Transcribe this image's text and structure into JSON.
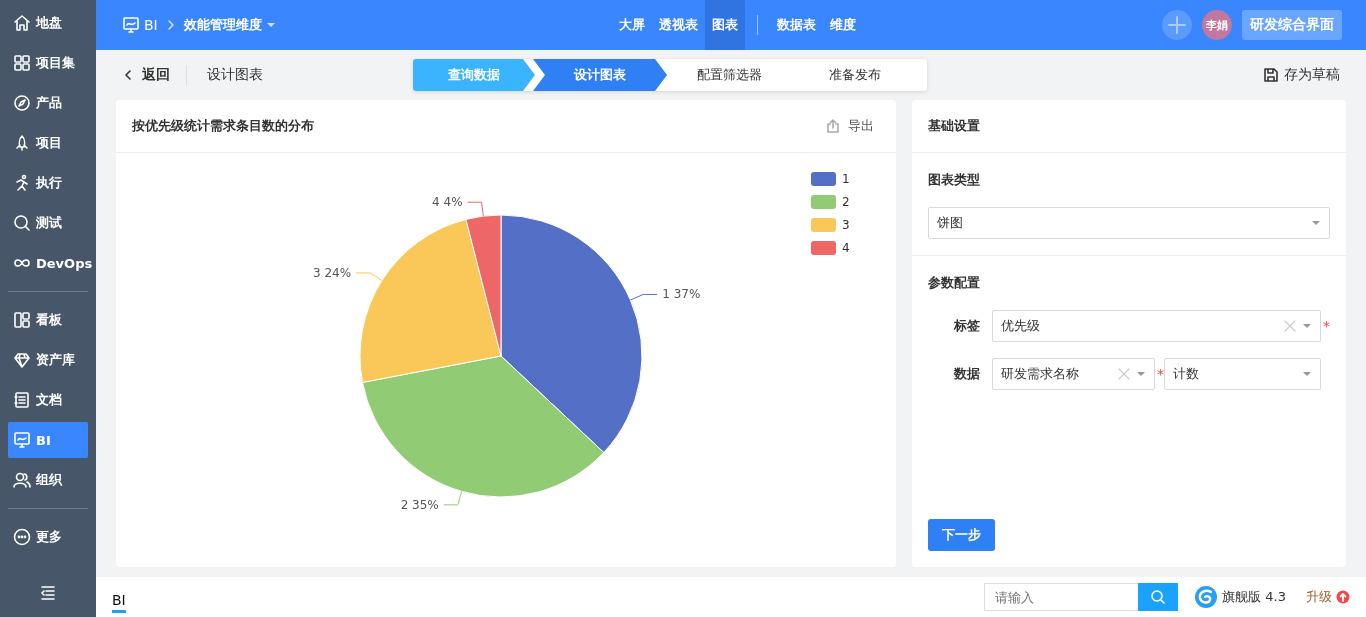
{
  "sidebar": {
    "groups": [
      [
        {
          "label": "地盘",
          "selected": false
        },
        {
          "label": "项目集",
          "selected": false
        },
        {
          "label": "产品",
          "selected": false
        },
        {
          "label": "项目",
          "selected": false
        },
        {
          "label": "执行",
          "selected": false
        },
        {
          "label": "测试",
          "selected": false
        },
        {
          "label": "DevOps",
          "selected": false
        }
      ],
      [
        {
          "label": "看板",
          "selected": false
        },
        {
          "label": "资产库",
          "selected": false
        },
        {
          "label": "文档",
          "selected": false
        },
        {
          "label": "BI",
          "selected": true
        },
        {
          "label": "组织",
          "selected": false
        }
      ],
      [
        {
          "label": "更多",
          "selected": false
        }
      ]
    ]
  },
  "header": {
    "app": "BI",
    "breadcrumb": "效能管理维度",
    "nav": [
      {
        "label": "大屏",
        "selected": false
      },
      {
        "label": "透视表",
        "selected": false
      },
      {
        "label": "图表",
        "selected": true
      }
    ],
    "nav2": [
      {
        "label": "数据表",
        "selected": false
      },
      {
        "label": "维度",
        "selected": false
      }
    ],
    "avatar": "李娟",
    "workspace_button": "研发综合界面"
  },
  "subheader": {
    "back": "返回",
    "title": "设计图表",
    "steps": [
      {
        "label": "查询数据",
        "completed": true,
        "selected": false
      },
      {
        "label": "设计图表",
        "completed": false,
        "selected": true
      },
      {
        "label": "配置筛选器",
        "completed": false,
        "selected": false
      },
      {
        "label": "准备发布",
        "completed": false,
        "selected": false
      }
    ],
    "save": "存为草稿"
  },
  "chart_panel": {
    "title": "按优先级统计需求条目数的分布",
    "export": "导出",
    "legend": [
      {
        "color": "#5470c6"
      },
      {
        "color": "#91cc75"
      },
      {
        "color": "#fac858"
      },
      {
        "color": "#ee6666"
      }
    ],
    "chart_data": {
      "type": "pie",
      "categories": [
        "1",
        "2",
        "3",
        "4"
      ],
      "values": [
        37,
        35,
        24,
        4
      ],
      "value_labels": [
        "1 37%",
        "2 35%",
        "3 24%",
        "4 4%"
      ]
    }
  },
  "settings": {
    "title": "基础设置",
    "chart_type_label": "图表类型",
    "chart_type": "饼图",
    "params_title": "参数配置",
    "fields": [
      {
        "label": "标签",
        "selects": [
          {
            "value": "优先级",
            "clearable": true,
            "required_mark": "*"
          }
        ]
      },
      {
        "label": "数据",
        "selects": [
          {
            "value": "研发需求名称",
            "clearable": true,
            "required_mark": "*"
          },
          {
            "value": "计数",
            "clearable": false
          }
        ]
      }
    ],
    "next": "下一步"
  },
  "footer": {
    "tab": "BI",
    "search_placeholder": "请输入",
    "edition": "旗舰版 4.3",
    "upgrade": "升级"
  }
}
